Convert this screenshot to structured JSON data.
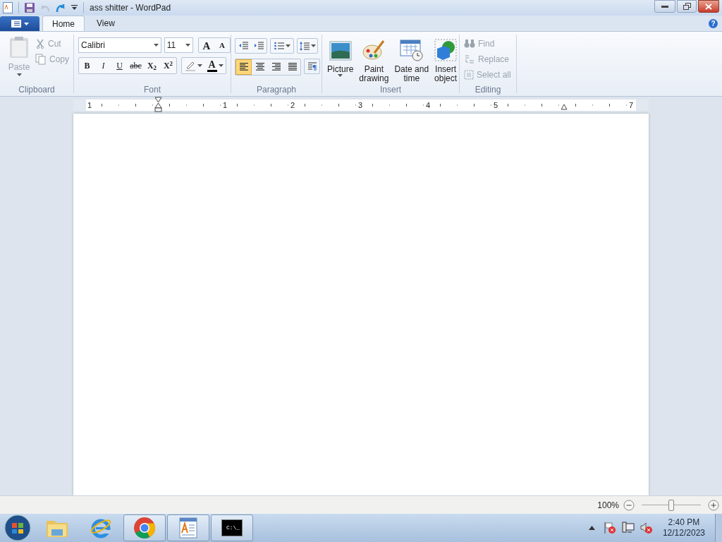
{
  "window": {
    "title": "ass shitter - WordPad"
  },
  "help": "?",
  "tabs": [
    {
      "label": "Home",
      "selected": true
    },
    {
      "label": "View",
      "selected": false
    }
  ],
  "ribbon": {
    "clipboard": {
      "label": "Clipboard",
      "paste": {
        "label": "Paste",
        "disabled": true
      },
      "small": [
        {
          "kind": "cut",
          "label": "Cut",
          "disabled": true
        },
        {
          "kind": "copy",
          "label": "Copy",
          "disabled": true
        }
      ]
    },
    "font": {
      "label": "Font",
      "family": "Calibri",
      "size": "11",
      "grow": "A",
      "shrink": "A",
      "format": [
        "B",
        "I",
        "U",
        "abc",
        "X$_{2}$",
        "X$^{2}$"
      ],
      "color_letter": "A"
    },
    "paragraph": {
      "label": "Paragraph",
      "align": [
        {
          "selected": true
        },
        {
          "selected": false
        },
        {
          "selected": false
        },
        {
          "selected": false
        }
      ]
    },
    "insert": {
      "label": "Insert",
      "buttons": [
        {
          "kind": "picture",
          "label": "Picture",
          "dropdown": true
        },
        {
          "kind": "paint",
          "label": "Paint drawing",
          "dropdown": false
        },
        {
          "kind": "datetime",
          "label": "Date and time",
          "dropdown": false
        },
        {
          "kind": "object",
          "label": "Insert object",
          "dropdown": false
        }
      ]
    },
    "editing": {
      "label": "Editing",
      "buttons": [
        {
          "kind": "find",
          "label": "Find",
          "disabled": true
        },
        {
          "kind": "replace",
          "label": "Replace",
          "disabled": true
        },
        {
          "kind": "selectall",
          "label": "Select all",
          "disabled": true
        }
      ]
    }
  },
  "ruler": {
    "labels": [
      "1",
      "1",
      "2",
      "3",
      "4",
      "5",
      "7"
    ]
  },
  "status_bar": {
    "zoom": "100%",
    "level": 0.5
  },
  "taskbar": {
    "apps": [
      {
        "kind": "explorer",
        "running": false
      },
      {
        "kind": "ie",
        "running": false
      },
      {
        "kind": "chrome",
        "running": true
      },
      {
        "kind": "wordpad",
        "running": true
      },
      {
        "kind": "cmd",
        "running": true,
        "text": "C:\\_"
      }
    ],
    "clock": {
      "time": "2:40 PM",
      "date": "12/12/2023"
    }
  }
}
